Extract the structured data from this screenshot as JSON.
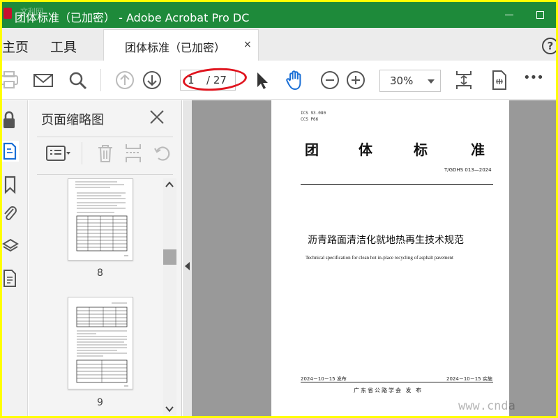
{
  "window": {
    "title": "团体标准（已加密） - Adobe Acrobat Pro DC",
    "watermark": "文利网"
  },
  "tabs": {
    "home": "主页",
    "tools": "工具",
    "document": "团体标准（已加密）",
    "close": "×"
  },
  "toolbar": {
    "page_current": "1",
    "page_total": "/ 27",
    "zoom": "30%",
    "more": "•••"
  },
  "thumbnails": {
    "header": "页面缩略图",
    "pages": [
      "8",
      "9"
    ]
  },
  "document": {
    "ics_code": "ICS 93.080",
    "ccs_code": "CCS P66",
    "title_chars": [
      "团",
      "体",
      "标",
      "准"
    ],
    "standard_number": "T/GDHS 013—2024",
    "title_zh": "沥青路面清洁化就地热再生技术规范",
    "title_en": "Technical specification for clean hot in-place recycling of asphalt pavement",
    "issue_date": "2024－10－15 发布",
    "implement_date": "2024－10－15 实施",
    "publisher": "广东省公路学会 发 布"
  },
  "watermark_url": "www.cnda",
  "colors": {
    "titlebar": "#1e8a3a",
    "frame_border": "#ffff00",
    "annotation": "#e0141e",
    "hand_tool": "#1a6fd6"
  }
}
